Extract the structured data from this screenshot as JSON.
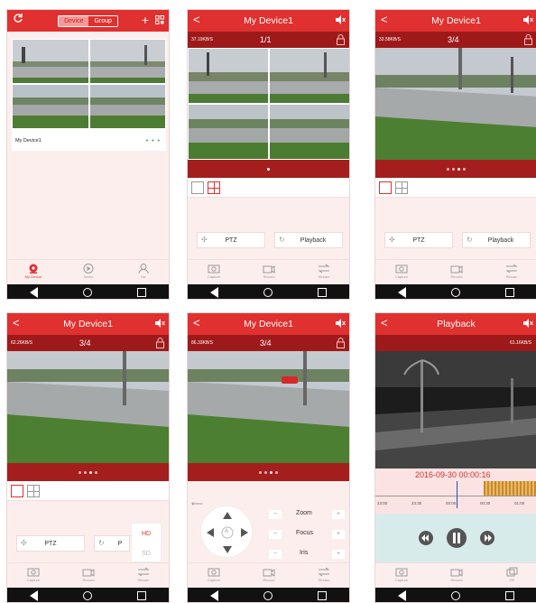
{
  "colors": {
    "primary": "#e0302f",
    "dark_red": "#9e1a1a",
    "background": "#fdeeee",
    "online": "#2aa84a"
  },
  "screen1": {
    "refresh_icon": "refresh-icon",
    "tab_device": "Device",
    "tab_group": "Group",
    "device_name": "My Device1",
    "status_dots": "• • •",
    "bottom_tabs": [
      "My Device",
      "Demo",
      "Me"
    ]
  },
  "screen2": {
    "title": "My Device1",
    "speed": "37.19KB/S",
    "page": "1/1",
    "ptz": "PTZ",
    "playback": "Playback",
    "bottom_tabs": [
      "Capture",
      "Record",
      "Stream"
    ]
  },
  "screen3": {
    "title": "My Device1",
    "speed": "33.58KB/S",
    "page": "3/4",
    "ptz": "PTZ",
    "playback": "Playback",
    "bottom_tabs": [
      "Capture",
      "Record",
      "Stream"
    ]
  },
  "screen4": {
    "title": "My Device1",
    "speed": "62.26KB/S",
    "page": "3/4",
    "ptz": "PTZ",
    "playback_partial": "P",
    "quality_options": [
      "HD",
      "SD"
    ],
    "bottom_tabs": [
      "Capture",
      "Record",
      "Stream"
    ]
  },
  "screen5": {
    "title": "My Device1",
    "speed": "86.33KB/S",
    "page": "3/4",
    "dpad_center": "A",
    "controls": [
      "Zoom",
      "Focus",
      "Iris"
    ],
    "bottom_tabs": [
      "Capture",
      "Record",
      "Stream"
    ]
  },
  "screen6": {
    "title": "Playback",
    "speed": "61.16KB/S",
    "timestamp": "2016-09-30 00:00:16",
    "time_ticks": [
      "23:00",
      "23:30",
      "00:00",
      "00:30",
      "01:00"
    ],
    "bottom_tabs": [
      "Capture",
      "Record",
      "Off"
    ]
  },
  "nav": {
    "back": "◁",
    "home": "○",
    "recent": "□"
  }
}
